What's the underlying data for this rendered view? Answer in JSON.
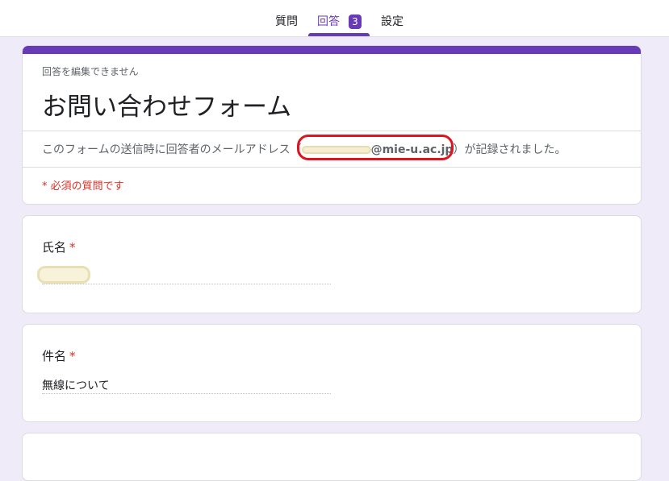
{
  "tabs": {
    "questions": "質問",
    "responses": "回答",
    "responses_count": "3",
    "settings": "設定"
  },
  "header": {
    "cannot_edit_note": "回答を編集できません",
    "title": "お問い合わせフォーム",
    "email_prefix": "このフォームの送信時に回答者のメールアドレス（",
    "email_domain": "@mie-u.ac.jp",
    "email_suffix": "）が記録されました。",
    "required_note": "* 必須の質問です"
  },
  "questions": [
    {
      "label": "氏名",
      "required_mark": "*",
      "answer": ""
    },
    {
      "label": "件名",
      "required_mark": "*",
      "answer": "無線について"
    }
  ],
  "colors": {
    "accent": "#673ab7",
    "background": "#f0ebf8",
    "required": "#d93025",
    "highlight": "#e0141f"
  }
}
